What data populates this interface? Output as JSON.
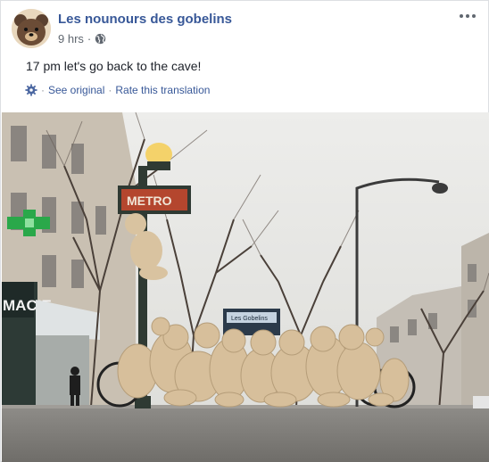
{
  "post": {
    "page_name": "Les nounours des gobelins",
    "time": "9 hrs",
    "privacy_icon": "globe-icon",
    "text": "17 pm let's go back to the cave!",
    "see_original": "See original",
    "rate_translation": "Rate this translation",
    "more_icon": "more-dots-icon",
    "settings_icon": "gear-icon"
  },
  "photo": {
    "metro_sign": "METRO",
    "station_sign": "Les Gobelins",
    "shop_sign": "MACIE"
  },
  "colors": {
    "link": "#385898",
    "secondary": "#606770",
    "text": "#1d2129"
  }
}
